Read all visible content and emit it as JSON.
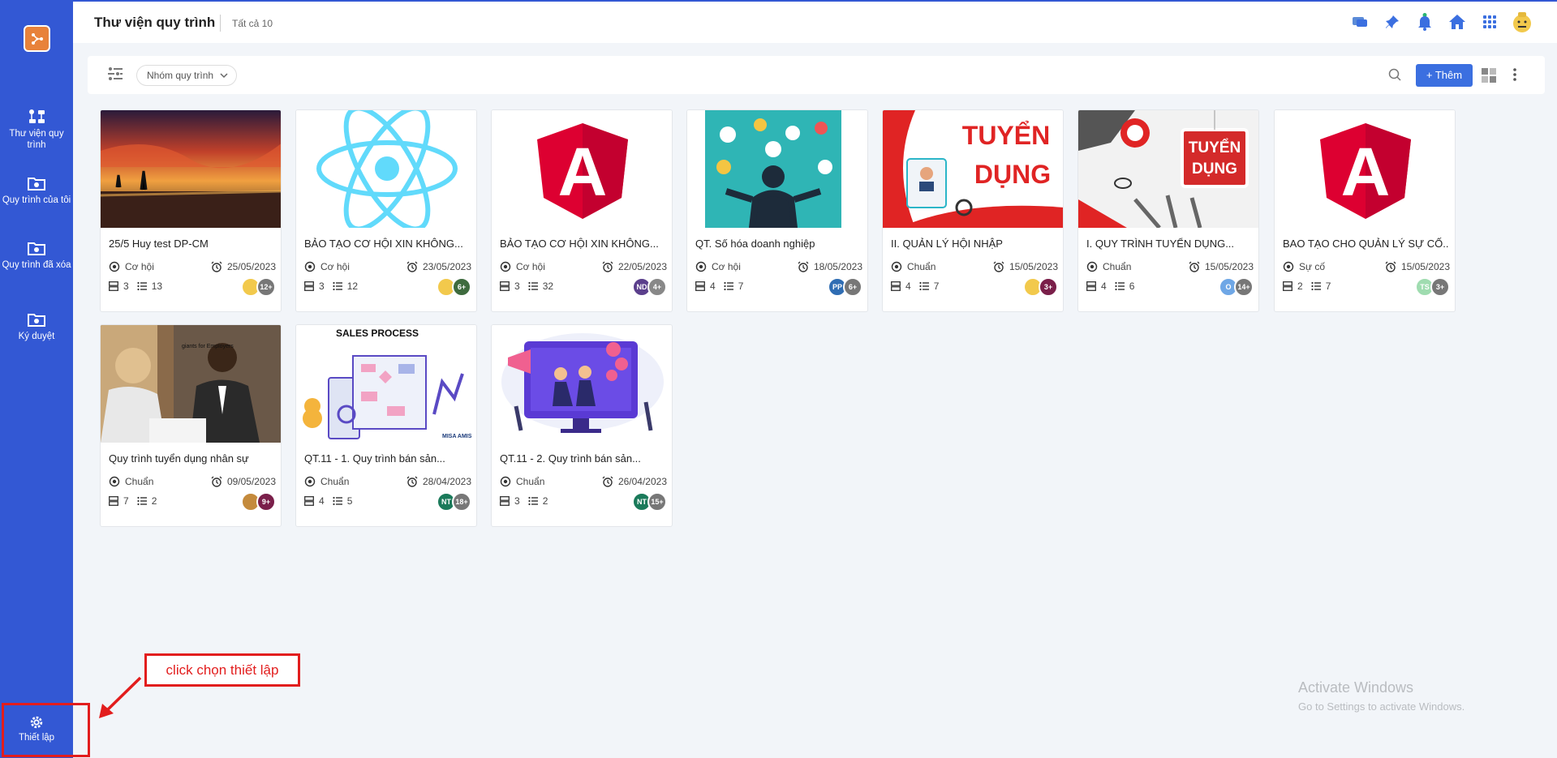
{
  "sidebar": {
    "items": [
      {
        "label": "Thư viện quy trình"
      },
      {
        "label": "Quy trình của tôi"
      },
      {
        "label": "Quy trình đã xóa"
      },
      {
        "label": "Ký duyệt"
      }
    ],
    "settings_label": "Thiết lập"
  },
  "header": {
    "title": "Thư viện quy trình",
    "count": "Tất cả 10",
    "icons": [
      "chat-icon",
      "pin-icon",
      "bell-icon",
      "home-icon",
      "apps-grid-icon",
      "user-avatar"
    ]
  },
  "toolbar": {
    "group_select": "Nhóm quy trình",
    "add_label": "+ Thêm"
  },
  "cards": [
    {
      "title": "25/5 Huy test DP-CM",
      "category": "Cơ hội",
      "date": "25/05/2023",
      "steps": "3",
      "tasks": "13",
      "avatars": [
        {
          "t": "",
          "c": "#f2c94c"
        },
        {
          "t": "12+",
          "c": "#777"
        }
      ]
    },
    {
      "title": "BẢO TẠO CƠ HỘI XIN KHÔNG...",
      "category": "Cơ hội",
      "date": "23/05/2023",
      "steps": "3",
      "tasks": "12",
      "avatars": [
        {
          "t": "",
          "c": "#f2c94c"
        },
        {
          "t": "6+",
          "c": "#3e6b3e"
        }
      ]
    },
    {
      "title": "BẢO TẠO CƠ HỘI XIN KHÔNG...",
      "category": "Cơ hội",
      "date": "22/05/2023",
      "steps": "3",
      "tasks": "32",
      "avatars": [
        {
          "t": "ND",
          "c": "#5b3f8c"
        },
        {
          "t": "4+",
          "c": "#888"
        }
      ]
    },
    {
      "title": "QT. Số hóa doanh nghiệp",
      "category": "Cơ hội",
      "date": "18/05/2023",
      "steps": "4",
      "tasks": "7",
      "avatars": [
        {
          "t": "PP",
          "c": "#2f6db3"
        },
        {
          "t": "6+",
          "c": "#777"
        }
      ]
    },
    {
      "title": "II. QUẢN LÝ HỘI NHẬP",
      "category": "Chuẩn",
      "date": "15/05/2023",
      "steps": "4",
      "tasks": "7",
      "avatars": [
        {
          "t": "",
          "c": "#f2c94c"
        },
        {
          "t": "3+",
          "c": "#7a1f4a"
        }
      ]
    },
    {
      "title": "I. QUY TRÌNH TUYỂN DỤNG...",
      "category": "Chuẩn",
      "date": "15/05/2023",
      "steps": "4",
      "tasks": "6",
      "avatars": [
        {
          "t": "O",
          "c": "#6fa7e6"
        },
        {
          "t": "14+",
          "c": "#777"
        }
      ]
    },
    {
      "title": "BAO TẠO CHO QUẢN LÝ SỰ CỐ...",
      "category": "Sự cố",
      "date": "15/05/2023",
      "steps": "2",
      "tasks": "7",
      "avatars": [
        {
          "t": "TS",
          "c": "#9fdcb0"
        },
        {
          "t": "3+",
          "c": "#777"
        }
      ]
    },
    {
      "title": "Quy trình tuyển dụng nhân sự",
      "category": "Chuẩn",
      "date": "09/05/2023",
      "steps": "7",
      "tasks": "2",
      "avatars": [
        {
          "t": "",
          "c": "#c48a3c"
        },
        {
          "t": "9+",
          "c": "#7a1f4a"
        }
      ]
    },
    {
      "title": "QT.11 - 1. Quy trình bán sản...",
      "category": "Chuẩn",
      "date": "28/04/2023",
      "steps": "4",
      "tasks": "5",
      "avatars": [
        {
          "t": "NT",
          "c": "#1a7a5a"
        },
        {
          "t": "18+",
          "c": "#777"
        }
      ]
    },
    {
      "title": "QT.11 - 2. Quy trình bán sản...",
      "category": "Chuẩn",
      "date": "26/04/2023",
      "steps": "3",
      "tasks": "2",
      "avatars": [
        {
          "t": "NT",
          "c": "#1a7a5a"
        },
        {
          "t": "15+",
          "c": "#777"
        }
      ]
    }
  ],
  "thumb_text": {
    "tuyen": "TUYỂN",
    "dung": "DỤNG",
    "sales": "SALES PROCESS",
    "angular": "A",
    "tuyen2": "TUYỂN",
    "dung2": "DỤNG",
    "giants": "giants for Employers",
    "misa": "MISA AMIS"
  },
  "annotation": "click chọn thiết lập",
  "watermark": {
    "line1": "Activate Windows",
    "line2": "Go to Settings to activate Windows."
  },
  "colors": {
    "sidebar": "#3358d4",
    "accent": "#3b6fe0",
    "annotation": "#e21d1d"
  }
}
